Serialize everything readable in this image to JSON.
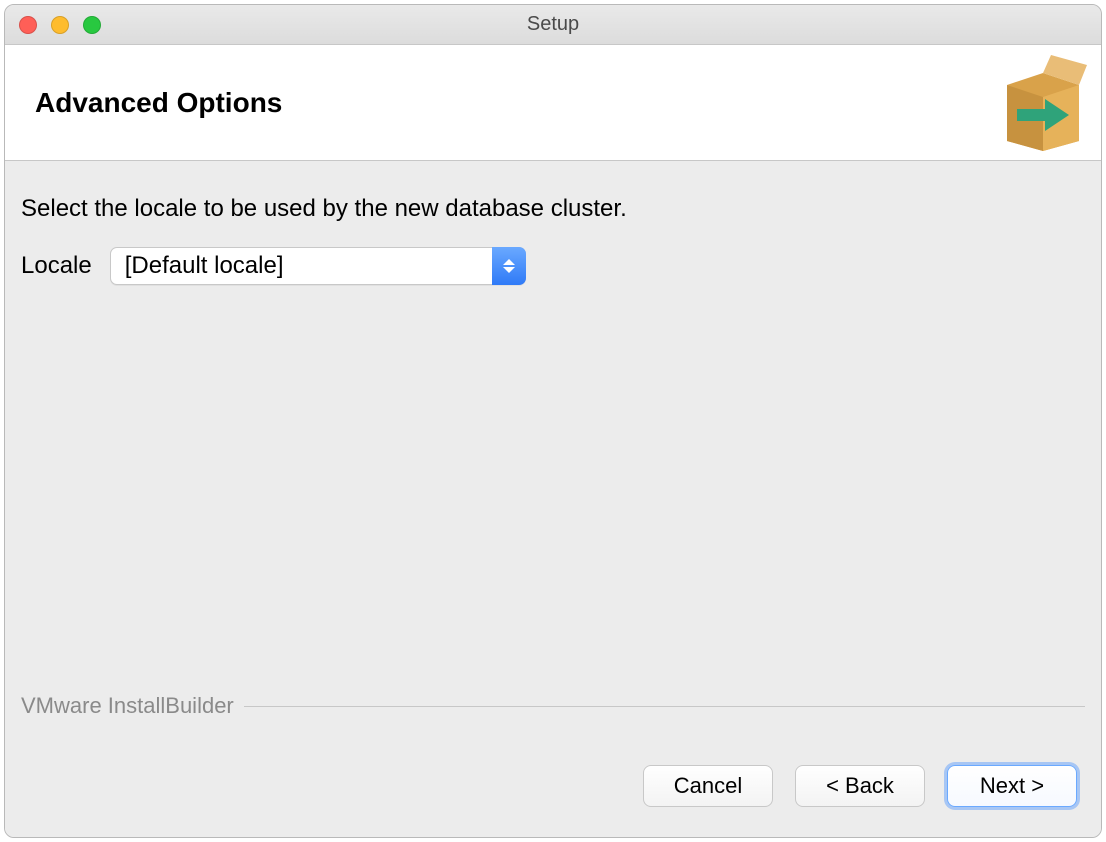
{
  "window": {
    "title": "Setup"
  },
  "header": {
    "title": "Advanced Options",
    "icon_name": "install-box-arrow-icon"
  },
  "content": {
    "instruction": "Select the locale to be used by the new database cluster.",
    "locale_label": "Locale",
    "locale_value": "[Default locale]"
  },
  "footer": {
    "brand": "VMware InstallBuilder",
    "buttons": {
      "cancel": "Cancel",
      "back": "< Back",
      "next": "Next >"
    }
  }
}
